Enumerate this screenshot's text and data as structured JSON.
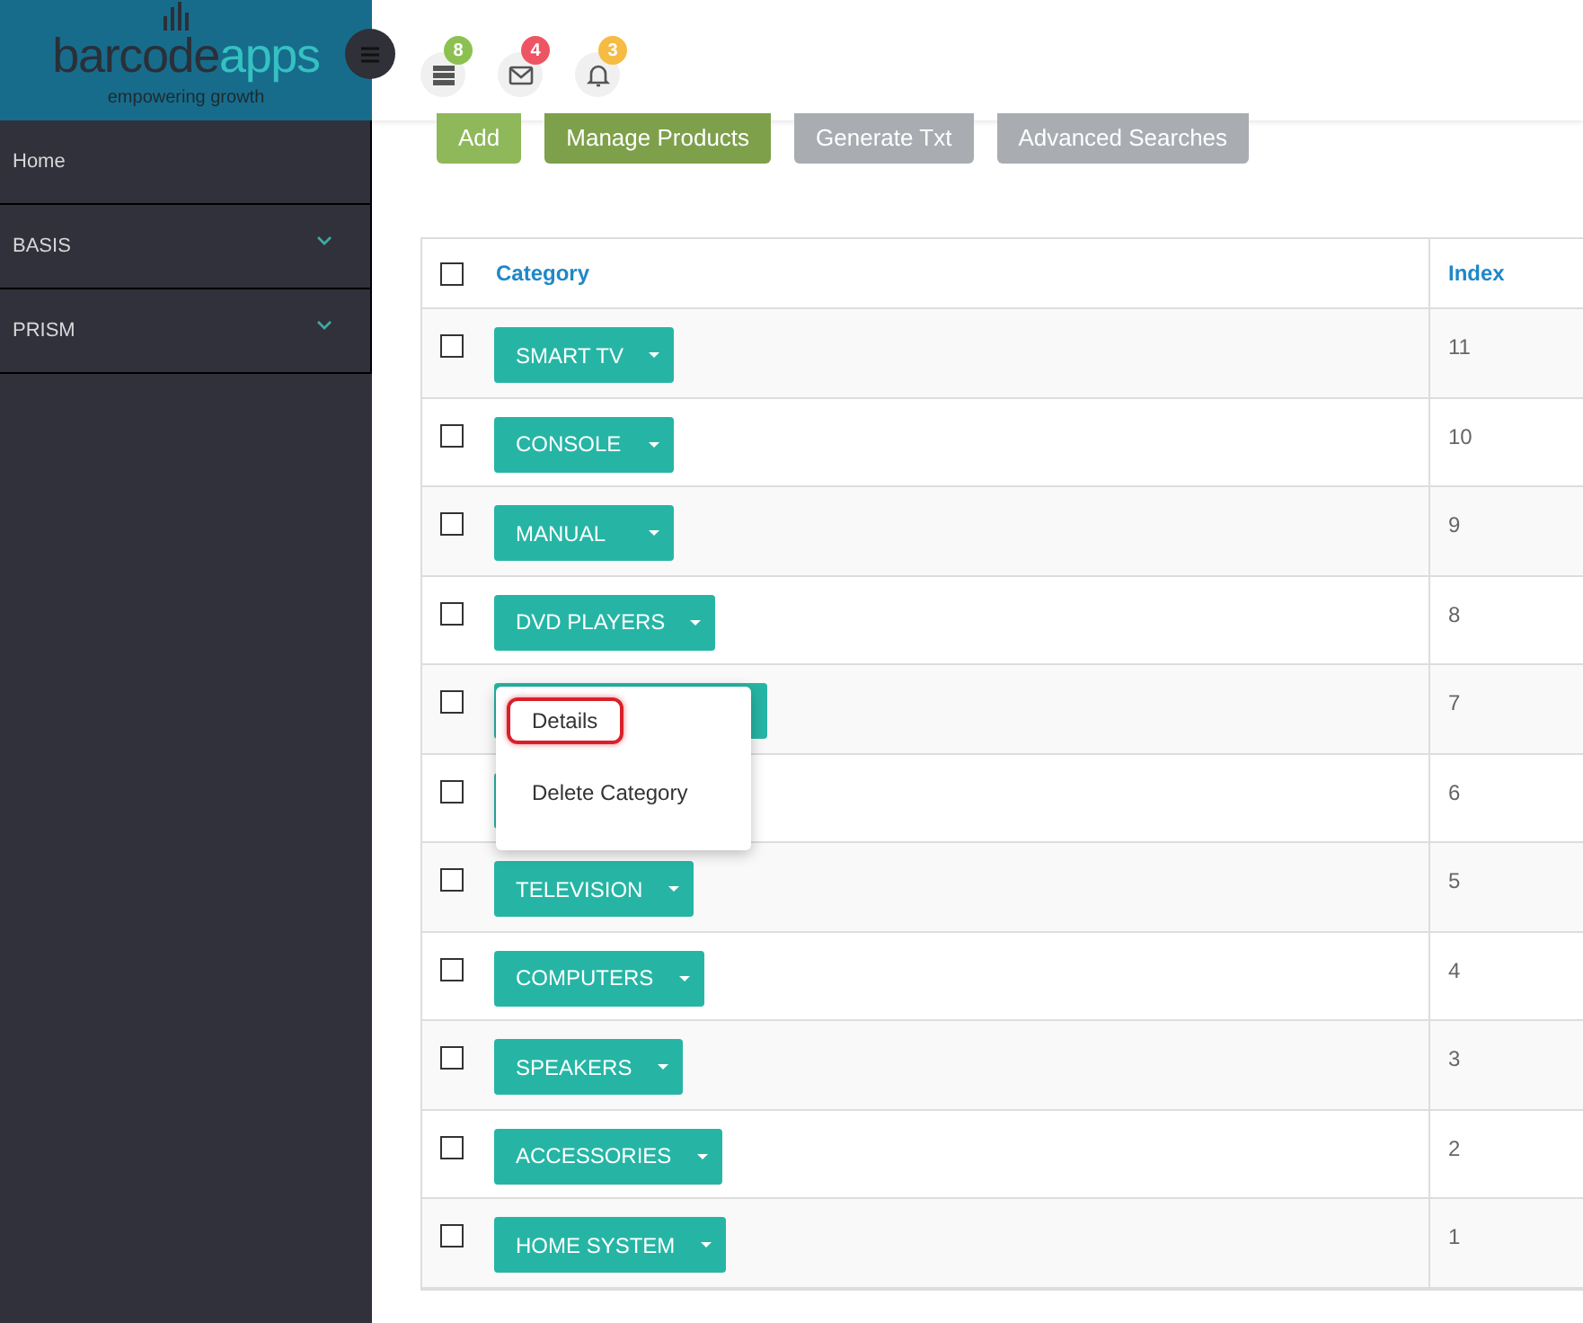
{
  "logo": {
    "name_dark": "barcode",
    "name_light": "apps",
    "tagline": "empowering growth"
  },
  "sidebar": {
    "items": [
      {
        "label": "Home",
        "expandable": false
      },
      {
        "label": "BASIS",
        "expandable": true
      },
      {
        "label": "PRISM",
        "expandable": true
      }
    ]
  },
  "header": {
    "icons": [
      {
        "kind": "server",
        "badge": "8",
        "color": "#8cc152"
      },
      {
        "kind": "mail",
        "badge": "4",
        "color": "#ed5565"
      },
      {
        "kind": "bell",
        "badge": "3",
        "color": "#f6bb42"
      }
    ]
  },
  "toolbar": {
    "buttons": [
      {
        "label": "Add",
        "kind": "success"
      },
      {
        "label": "Manage Products",
        "kind": "primary"
      },
      {
        "label": "Generate Txt",
        "kind": "muted"
      },
      {
        "label": "Advanced Searches",
        "kind": "muted"
      }
    ]
  },
  "table": {
    "header_checked": false,
    "columns": [
      "Category",
      "Index"
    ],
    "rows": [
      {
        "checked": false,
        "category": "SMART TV",
        "index": "11"
      },
      {
        "checked": false,
        "category": "CONSOLE",
        "index": "10"
      },
      {
        "checked": false,
        "category": "MANUAL",
        "index": "9"
      },
      {
        "checked": false,
        "category": "DVD PLAYERS",
        "index": "8"
      },
      {
        "checked": false,
        "index": "7",
        "menu_open": true
      },
      {
        "checked": false,
        "index": "6"
      },
      {
        "checked": false,
        "category": "TELEVISION",
        "index": "5"
      },
      {
        "checked": false,
        "category": "COMPUTERS",
        "index": "4"
      },
      {
        "checked": false,
        "category": "SPEAKERS",
        "index": "3"
      },
      {
        "checked": false,
        "category": "ACCESSORIES",
        "index": "2"
      },
      {
        "checked": false,
        "category": "HOME SYSTEM",
        "index": "1"
      }
    ]
  },
  "dropdown_menu": {
    "items": [
      {
        "label": "Details",
        "highlighted": true
      },
      {
        "label": "Delete Category",
        "highlighted": false
      }
    ]
  }
}
